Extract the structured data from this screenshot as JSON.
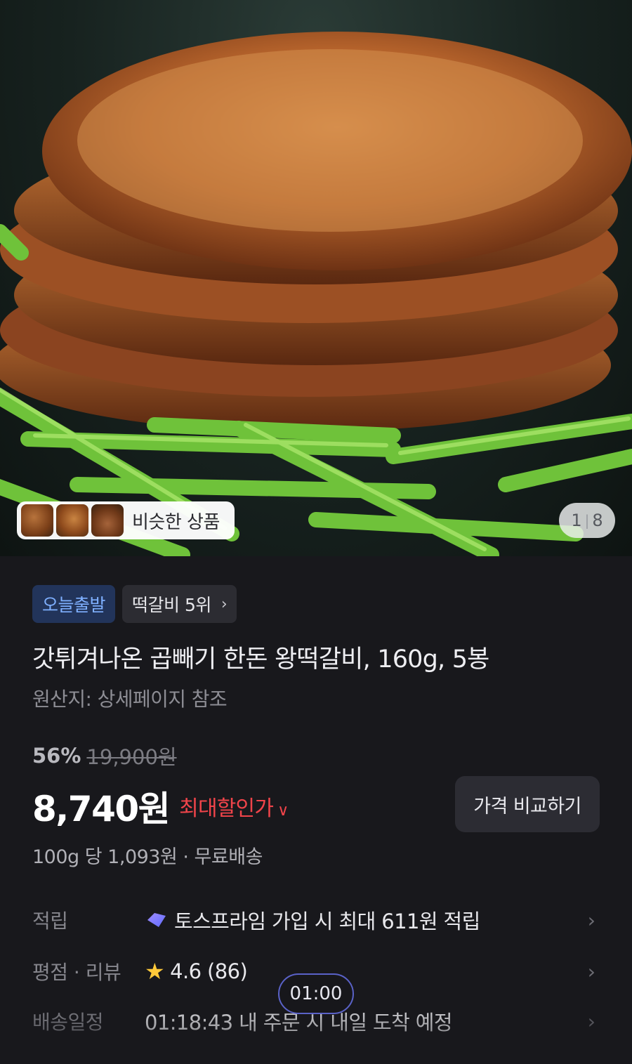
{
  "hero": {
    "similar_label": "비슷한 상품",
    "page_current": "1",
    "page_total": "8"
  },
  "badges": {
    "today_ship": "오늘출발",
    "rank": "떡갈비 5위"
  },
  "product": {
    "title": "갓튀겨나온 곱빼기 한돈 왕떡갈비, 160g, 5봉",
    "origin": "원산지: 상세페이지 참조",
    "discount_rate": "56%",
    "original_price": "19,900원",
    "price": "8,740원",
    "max_discount_label": "최대할인가",
    "compare_label": "가격 비교하기",
    "unit_info": "100g 당 1,093원 · 무료배송"
  },
  "rows": {
    "points_label": "적립",
    "points_value": "토스프라임 가입 시 최대 611원 적립",
    "rating_label": "평점 · 리뷰",
    "rating_value": "4.6 (86)",
    "delivery_label": "배송일정",
    "delivery_value": "01:18:43 내 주문 시 내일 도착 예정"
  },
  "timer": "01:00",
  "colors": {
    "background": "#18181c",
    "accent_red": "#f0444a",
    "badge_blue": "#7fb0ff",
    "star": "#ffc93a"
  },
  "icons": [
    "chevron-right-icon",
    "chevron-down-icon",
    "prime-icon",
    "star-icon"
  ]
}
